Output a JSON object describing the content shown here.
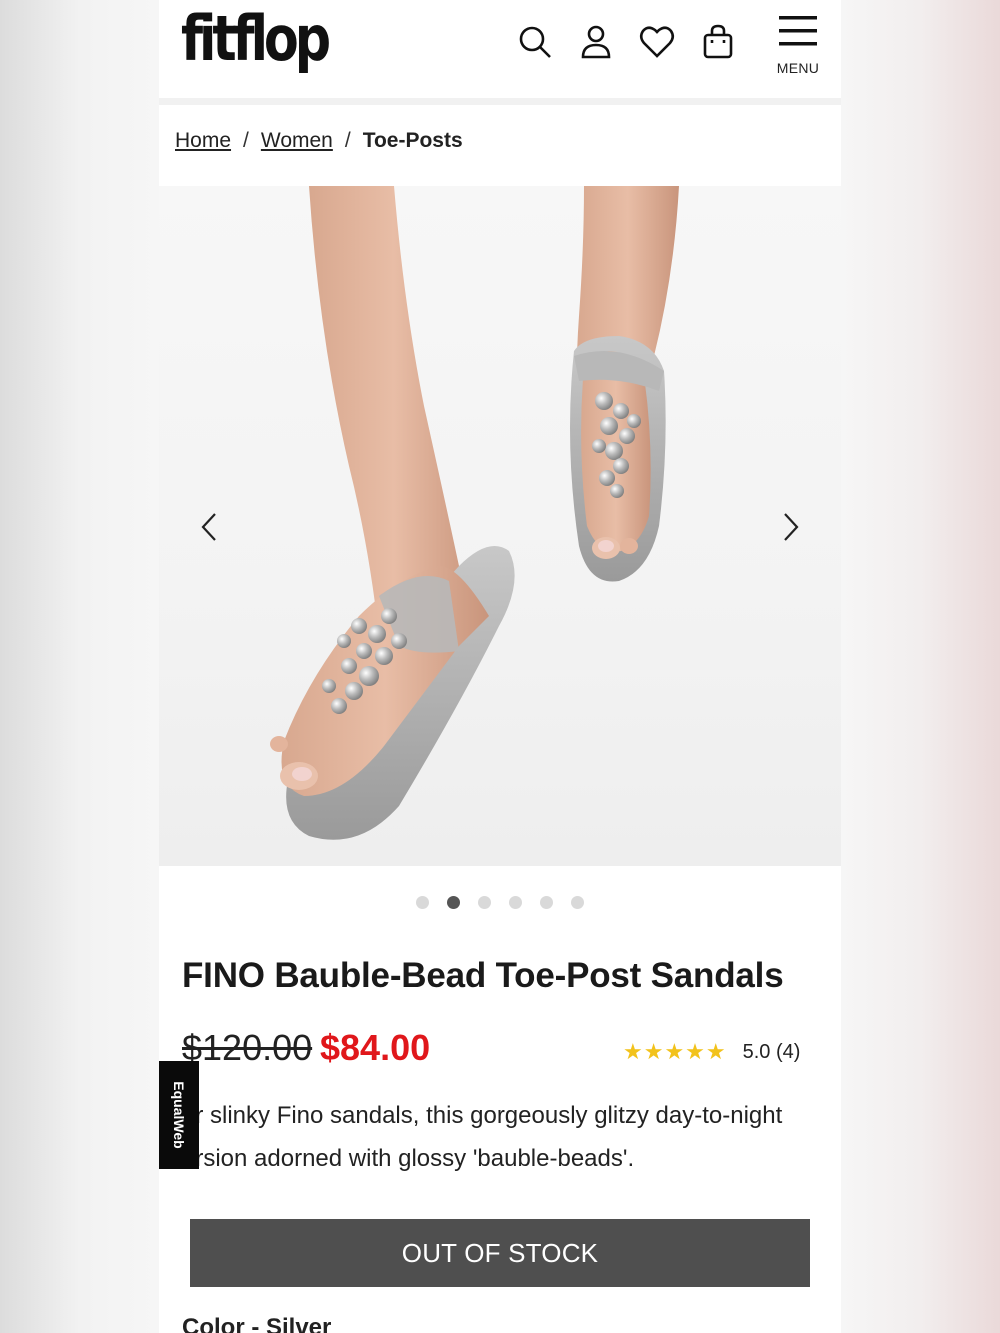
{
  "header": {
    "logo": "fitflop",
    "menu_label": "MENU",
    "icons": [
      "search-icon",
      "account-icon",
      "wishlist-heart-icon",
      "shopping-bag-icon",
      "hamburger-menu-icon"
    ]
  },
  "breadcrumb": {
    "items": [
      {
        "label": "Home"
      },
      {
        "label": "Women"
      },
      {
        "label": "Toe-Posts"
      }
    ],
    "separator": "/"
  },
  "carousel": {
    "image_alt": "Model wearing silver beaded toe-post sandals",
    "prev_icon": "chevron-left-icon",
    "next_icon": "chevron-right-icon",
    "slide_count": 6,
    "active_slide": 2
  },
  "product": {
    "title": "FINO Bauble-Bead Toe-Post Sandals",
    "price_original": "$120.00",
    "price_sale": "$84.00",
    "stars": "★★★★★",
    "rating_text": "5.0 (4)",
    "description": "ur slinky Fino sandals, this gorgeously glitzy day-to-night ersion adorned with glossy 'bauble-beads'.",
    "button_label": "OUT OF STOCK",
    "color_label": "Color - Silver"
  },
  "accessibility_widget": {
    "label": "EqualWeb"
  },
  "colors": {
    "sale_price": "#e0171b",
    "star": "#f2c21b",
    "button_bg": "#4f4f4f"
  }
}
